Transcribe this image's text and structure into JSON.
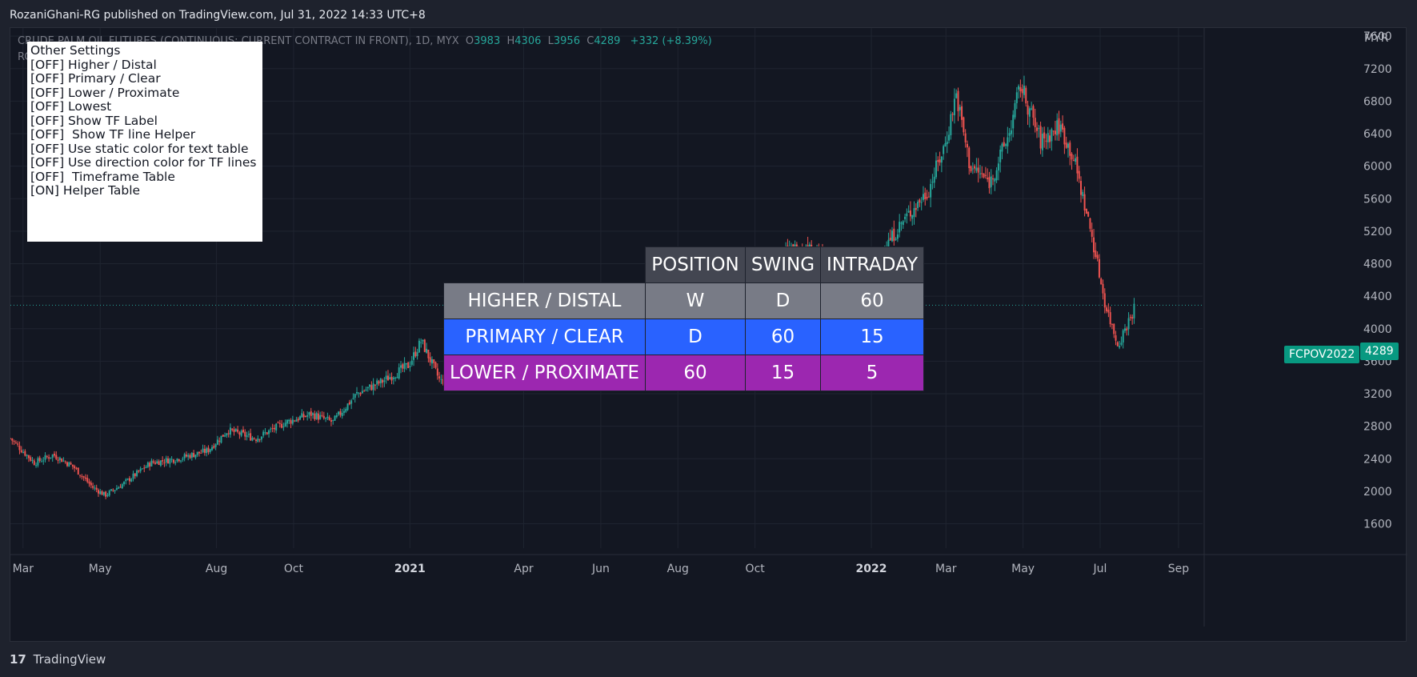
{
  "header": {
    "published_text": "RozaniGhani-RG published on TradingView.com, Jul 31, 2022 14:33 UTC+8"
  },
  "symbol": {
    "title": "CRUDE PALM OIL FUTURES (CONTINUOUS: CURRENT CONTRACT IN FRONT), 1D, MYX",
    "o_label": "O",
    "o": "3983",
    "h_label": "H",
    "h": "4306",
    "l_label": "L",
    "l": "3956",
    "c_label": "C",
    "c": "4289",
    "change": "+332 (+8.39%)",
    "indicator": "RCAM"
  },
  "settings_box": {
    "lines": [
      "Other Settings",
      "",
      "[OFF] Higher / Distal",
      "[OFF] Primary / Clear",
      "[OFF] Lower / Proximate",
      "[OFF] Lowest",
      "[OFF] Show TF Label",
      "[OFF]  Show TF line Helper",
      "",
      "[OFF] Use static color for text table",
      "[OFF] Use direction color for TF lines",
      "",
      "[OFF]  Timeframe Table",
      "[ON] Helper Table"
    ]
  },
  "helper_table": {
    "headers": [
      "POSITION",
      "SWING",
      "INTRADAY"
    ],
    "rows": [
      {
        "label": "HIGHER / DISTAL",
        "cells": [
          "W",
          "D",
          "60"
        ]
      },
      {
        "label": "PRIMARY / CLEAR",
        "cells": [
          "D",
          "60",
          "15"
        ]
      },
      {
        "label": "LOWER / PROXIMATE",
        "cells": [
          "60",
          "15",
          "5"
        ]
      }
    ]
  },
  "price_labels": {
    "series_tag": "FCPOV2022",
    "last_price": "4289",
    "currency": "MYR"
  },
  "footer": {
    "brand": "TradingView",
    "logo_text": "17"
  },
  "colors": {
    "up": "#26a69a",
    "down": "#ef5350",
    "grid": "#1f2430",
    "background": "#131722",
    "higher_row": "#787b86",
    "primary_row": "#2962ff",
    "lower_row": "#9c27b0"
  },
  "chart_data": {
    "type": "candlestick",
    "title": "CRUDE PALM OIL FUTURES (CONTINUOUS: CURRENT CONTRACT IN FRONT), 1D, MYX",
    "ylabel": "MYR",
    "ylim": [
      1300,
      7700
    ],
    "y_ticks": [
      1600,
      2000,
      2400,
      2800,
      3200,
      3600,
      4000,
      4400,
      4800,
      5200,
      5600,
      6000,
      6400,
      6800,
      7200,
      7600
    ],
    "x_ticks": [
      {
        "label": "Mar",
        "date": "2020-03-01",
        "bold": false
      },
      {
        "label": "May",
        "date": "2020-05-01",
        "bold": false
      },
      {
        "label": "Aug",
        "date": "2020-08-01",
        "bold": false
      },
      {
        "label": "Oct",
        "date": "2020-10-01",
        "bold": false
      },
      {
        "label": "2021",
        "date": "2021-01-01",
        "bold": true
      },
      {
        "label": "Apr",
        "date": "2021-04-01",
        "bold": false
      },
      {
        "label": "Jun",
        "date": "2021-06-01",
        "bold": false
      },
      {
        "label": "Aug",
        "date": "2021-08-01",
        "bold": false
      },
      {
        "label": "Oct",
        "date": "2021-10-01",
        "bold": false
      },
      {
        "label": "2022",
        "date": "2022-01-01",
        "bold": true
      },
      {
        "label": "Mar",
        "date": "2022-03-01",
        "bold": false
      },
      {
        "label": "May",
        "date": "2022-05-01",
        "bold": false
      },
      {
        "label": "Jul",
        "date": "2022-07-01",
        "bold": false
      },
      {
        "label": "Sep",
        "date": "2022-09-01",
        "bold": false
      }
    ],
    "xlim": [
      "2020-02-20",
      "2022-09-20"
    ],
    "close_path": [
      [
        "2020-02-20",
        2650
      ],
      [
        "2020-03-10",
        2350
      ],
      [
        "2020-03-25",
        2450
      ],
      [
        "2020-04-10",
        2300
      ],
      [
        "2020-04-25",
        2050
      ],
      [
        "2020-05-05",
        1950
      ],
      [
        "2020-05-20",
        2100
      ],
      [
        "2020-06-10",
        2350
      ],
      [
        "2020-07-01",
        2400
      ],
      [
        "2020-07-25",
        2500
      ],
      [
        "2020-08-10",
        2750
      ],
      [
        "2020-09-01",
        2650
      ],
      [
        "2020-09-25",
        2850
      ],
      [
        "2020-10-15",
        2950
      ],
      [
        "2020-11-01",
        2850
      ],
      [
        "2020-11-20",
        3200
      ],
      [
        "2020-12-10",
        3350
      ],
      [
        "2020-12-31",
        3550
      ],
      [
        "2021-01-10",
        3850
      ],
      [
        "2021-01-25",
        3350
      ],
      [
        "2021-02-10",
        3450
      ],
      [
        "2021-03-01",
        3650
      ],
      [
        "2021-03-20",
        3850
      ],
      [
        "2021-04-05",
        3700
      ],
      [
        "2021-04-25",
        4100
      ],
      [
        "2021-05-10",
        4400
      ],
      [
        "2021-05-25",
        4200
      ],
      [
        "2021-06-05",
        3800
      ],
      [
        "2021-06-20",
        3400
      ],
      [
        "2021-07-10",
        3600
      ],
      [
        "2021-07-25",
        4100
      ],
      [
        "2021-08-20",
        4450
      ],
      [
        "2021-09-20",
        4600
      ],
      [
        "2021-10-15",
        4900
      ],
      [
        "2021-11-05",
        5000
      ],
      [
        "2021-11-25",
        4900
      ],
      [
        "2021-12-10",
        4500
      ],
      [
        "2021-12-20",
        4300
      ],
      [
        "2022-01-05",
        4850
      ],
      [
        "2022-01-25",
        5300
      ],
      [
        "2022-02-15",
        5700
      ],
      [
        "2022-03-01",
        6300
      ],
      [
        "2022-03-09",
        6900
      ],
      [
        "2022-03-20",
        6000
      ],
      [
        "2022-04-05",
        5800
      ],
      [
        "2022-04-20",
        6400
      ],
      [
        "2022-04-29",
        7000
      ],
      [
        "2022-05-15",
        6300
      ],
      [
        "2022-05-30",
        6500
      ],
      [
        "2022-06-10",
        6100
      ],
      [
        "2022-06-25",
        5100
      ],
      [
        "2022-07-05",
        4300
      ],
      [
        "2022-07-15",
        3800
      ],
      [
        "2022-07-29",
        4289
      ]
    ]
  }
}
